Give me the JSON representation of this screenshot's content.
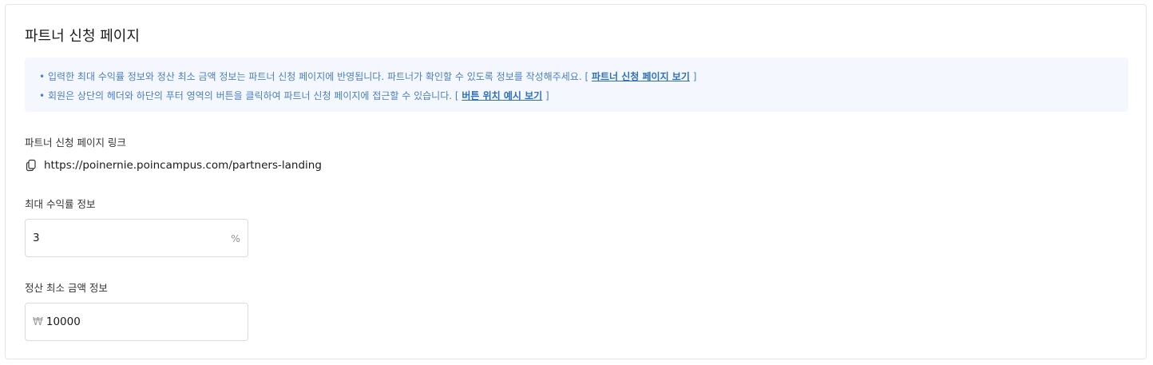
{
  "section": {
    "title": "파트너 신청 페이지"
  },
  "notice": {
    "line1_text": "입력한 최대 수익률 정보와 정산 최소 금액 정보는 파트너 신청 페이지에 반영됩니다. 파트너가 확인할 수 있도록 정보를 작성해주세요. [ ",
    "line1_link": "파트너 신청 페이지 보기",
    "line1_close": " ]",
    "line2_text": "회원은 상단의 헤더와 하단의 푸터 영역의 버튼을 클릭하여 파트너 신청 페이지에 접근할 수 있습니다. [ ",
    "line2_link": "버튼 위치 예시 보기",
    "line2_close": " ]",
    "bullet": "•"
  },
  "partner_link": {
    "label": "파트너 신청 페이지 링크",
    "url": "https://poinernie.poincampus.com/partners-landing",
    "icon": "copy-icon"
  },
  "max_rate": {
    "label": "최대 수익률 정보",
    "value": "3",
    "suffix": "%"
  },
  "min_amount": {
    "label": "정산 최소 금액 정보",
    "prefix": "₩",
    "value": "10000"
  }
}
